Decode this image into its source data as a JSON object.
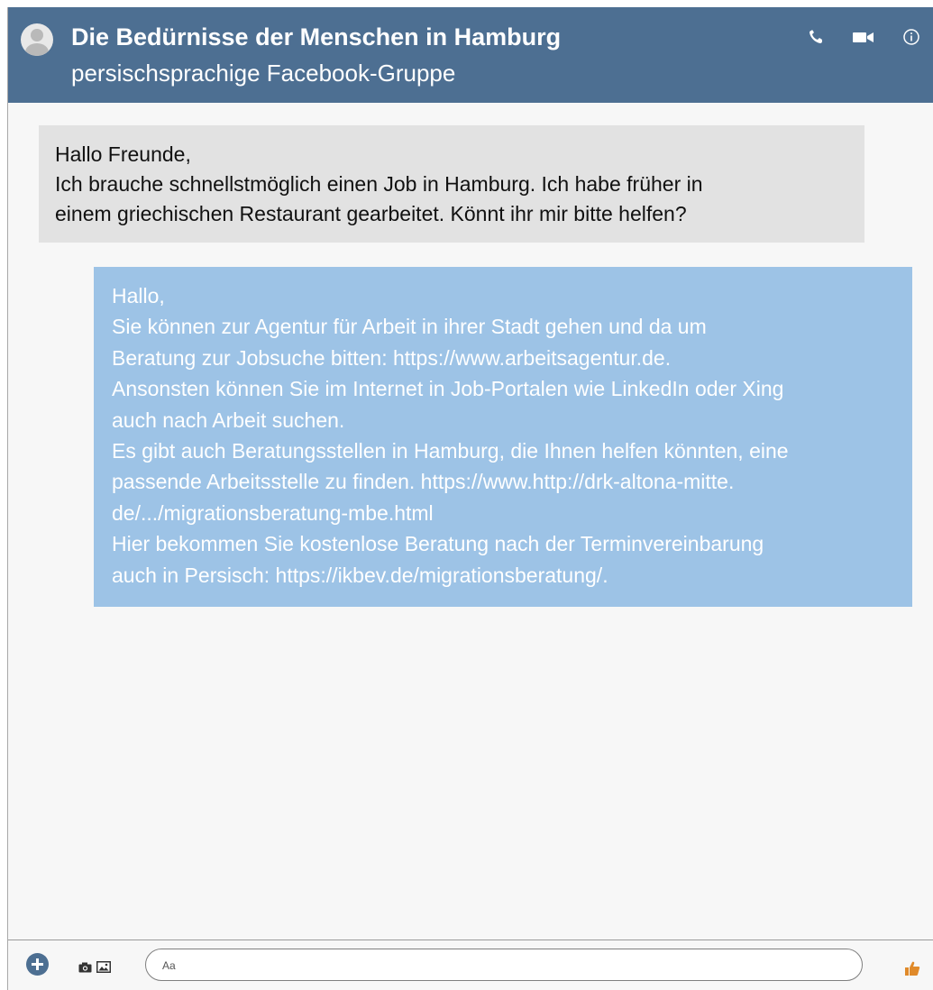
{
  "header": {
    "title": "Die Bedürnisse der Menschen in Hamburg",
    "subtitle": "persischsprachige Facebook-Gruppe",
    "icons": [
      "phone-icon",
      "video-camera-icon",
      "info-icon"
    ]
  },
  "messages": [
    {
      "direction": "incoming",
      "lines": [
        "Hallo Freunde,",
        "Ich brauche schnellstmöglich einen Job in Hamburg. Ich habe früher in",
        "einem griechischen Restaurant gearbeitet. Könnt ihr mir bitte helfen?"
      ]
    },
    {
      "direction": "outgoing",
      "lines": [
        "Hallo,",
        "Sie können zur Agentur für Arbeit in ihrer Stadt gehen und da um",
        "Beratung zur Jobsuche bitten: https://www.arbeitsagentur.de.",
        "Ansonsten können Sie im Internet in Job-Portalen wie LinkedIn oder Xing",
        "auch nach Arbeit suchen.",
        "Es gibt auch Beratungsstellen in Hamburg, die Ihnen helfen könnten, eine",
        "passende Arbeitsstelle zu finden. https://www.http://drk-altona-mitte.",
        "de/.../migrationsberatung-mbe.html",
        "Hier bekommen Sie kostenlose Beratung nach der Terminvereinbarung",
        "auch in Persisch: https://ikbev.de/migrationsberatung/."
      ]
    }
  ],
  "composer": {
    "placeholder": "Aa",
    "icons": [
      "plus-icon",
      "camera-icon",
      "gallery-icon",
      "thumbs-up-icon"
    ]
  },
  "colors": {
    "header_bg": "#4d6f92",
    "incoming_bg": "#e2e2e2",
    "outgoing_bg": "#9dc3e6",
    "canvas_bg": "#f7f7f7"
  }
}
